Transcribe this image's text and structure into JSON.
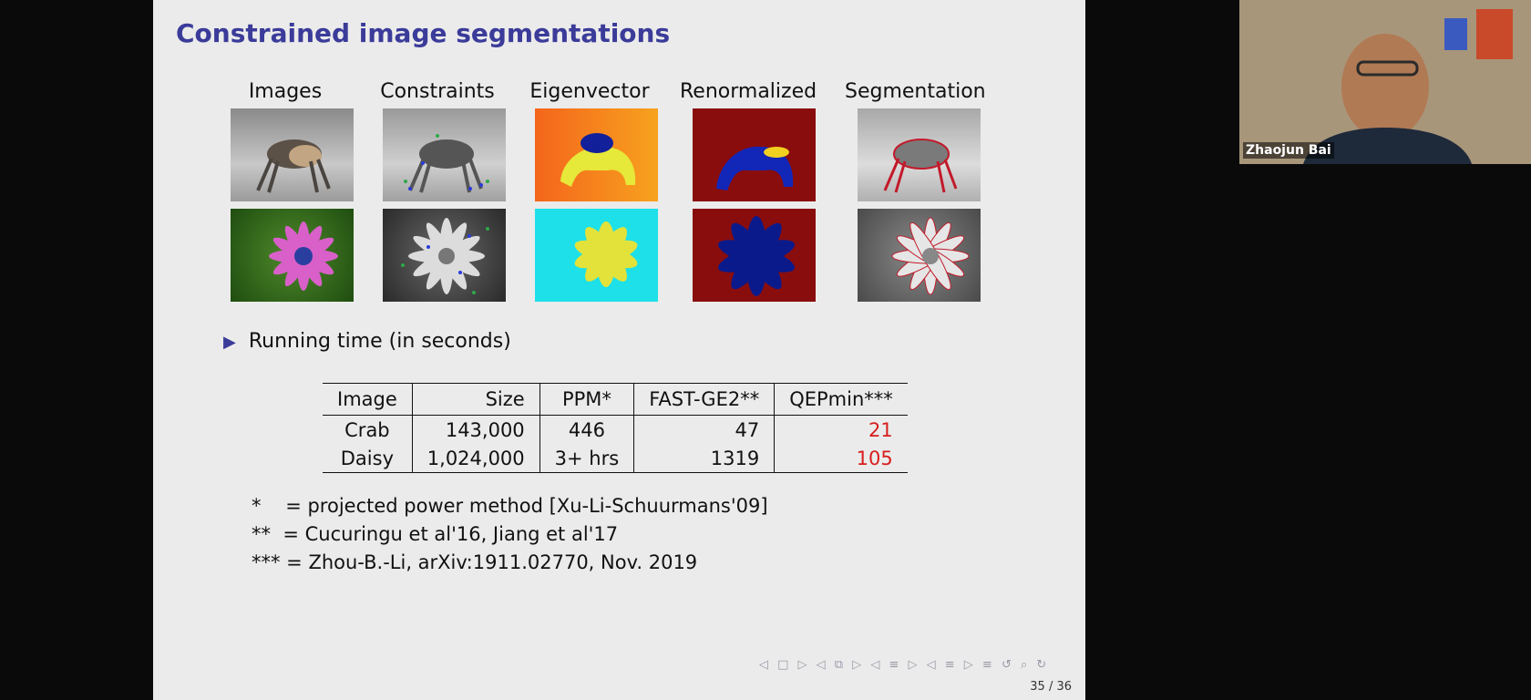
{
  "slide": {
    "title": "Constrained image segmentations",
    "columns": [
      "Images",
      "Constraints",
      "Eigenvector",
      "Renormalized",
      "Segmentation"
    ],
    "bullet": "Running time (in seconds)",
    "table": {
      "headers": [
        "Image",
        "Size",
        "PPM*",
        "FAST-GE2**",
        "QEPmin***"
      ],
      "rows": [
        [
          "Crab",
          "143,000",
          "446",
          "47",
          "21"
        ],
        [
          "Daisy",
          "1,024,000",
          "3+ hrs",
          "1319",
          "105"
        ]
      ]
    },
    "notes": [
      "*    = projected power method [Xu-Li-Schuurmans'09]",
      "**  = Cucuringu et al'16, Jiang et al'17",
      "*** = Zhou-B.-Li, arXiv:1911.02770, Nov. 2019"
    ],
    "nav_icons": "◁ □ ▷ ◁ ⧉ ▷ ◁ ≡ ▷ ◁ ≡ ▷ ≡ ↺ ⌕ ↻",
    "page_indicator": "35 / 36"
  },
  "video": {
    "participant_name": "Zhaojun Bai"
  },
  "colors": {
    "title": "#3b3b9a",
    "highlight": "#d81e1e",
    "slide_bg": "#ebebeb"
  }
}
